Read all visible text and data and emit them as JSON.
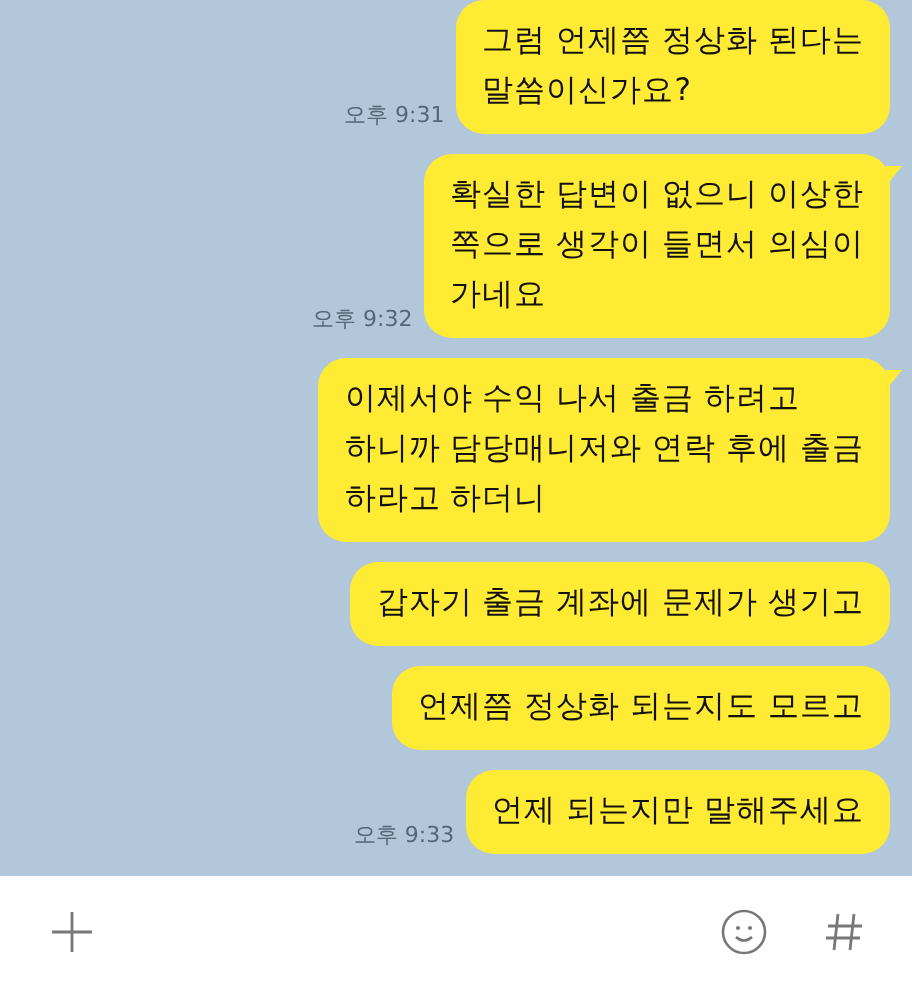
{
  "messages": [
    {
      "text": "그럼 언제쯤 정상화 된다는\n말씀이신가요?",
      "time": "오후 9:31",
      "tail": false
    },
    {
      "text": "확실한 답변이 없으니 이상한\n쪽으로 생각이 들면서 의심이\n가네요",
      "time": "오후 9:32",
      "tail": true
    },
    {
      "text": "이제서야 수익 나서 출금 하려고\n하니까 담당매니저와 연락 후에 출금\n하라고 하더니",
      "tail": true
    },
    {
      "text": "갑자기 출금 계좌에 문제가 생기고",
      "tail": false
    },
    {
      "text": "언제쯤 정상화 되는지도 모르고",
      "tail": false
    },
    {
      "text": "언제 되는지만 말해주세요",
      "time": "오후 9:33",
      "tail": false
    }
  ]
}
